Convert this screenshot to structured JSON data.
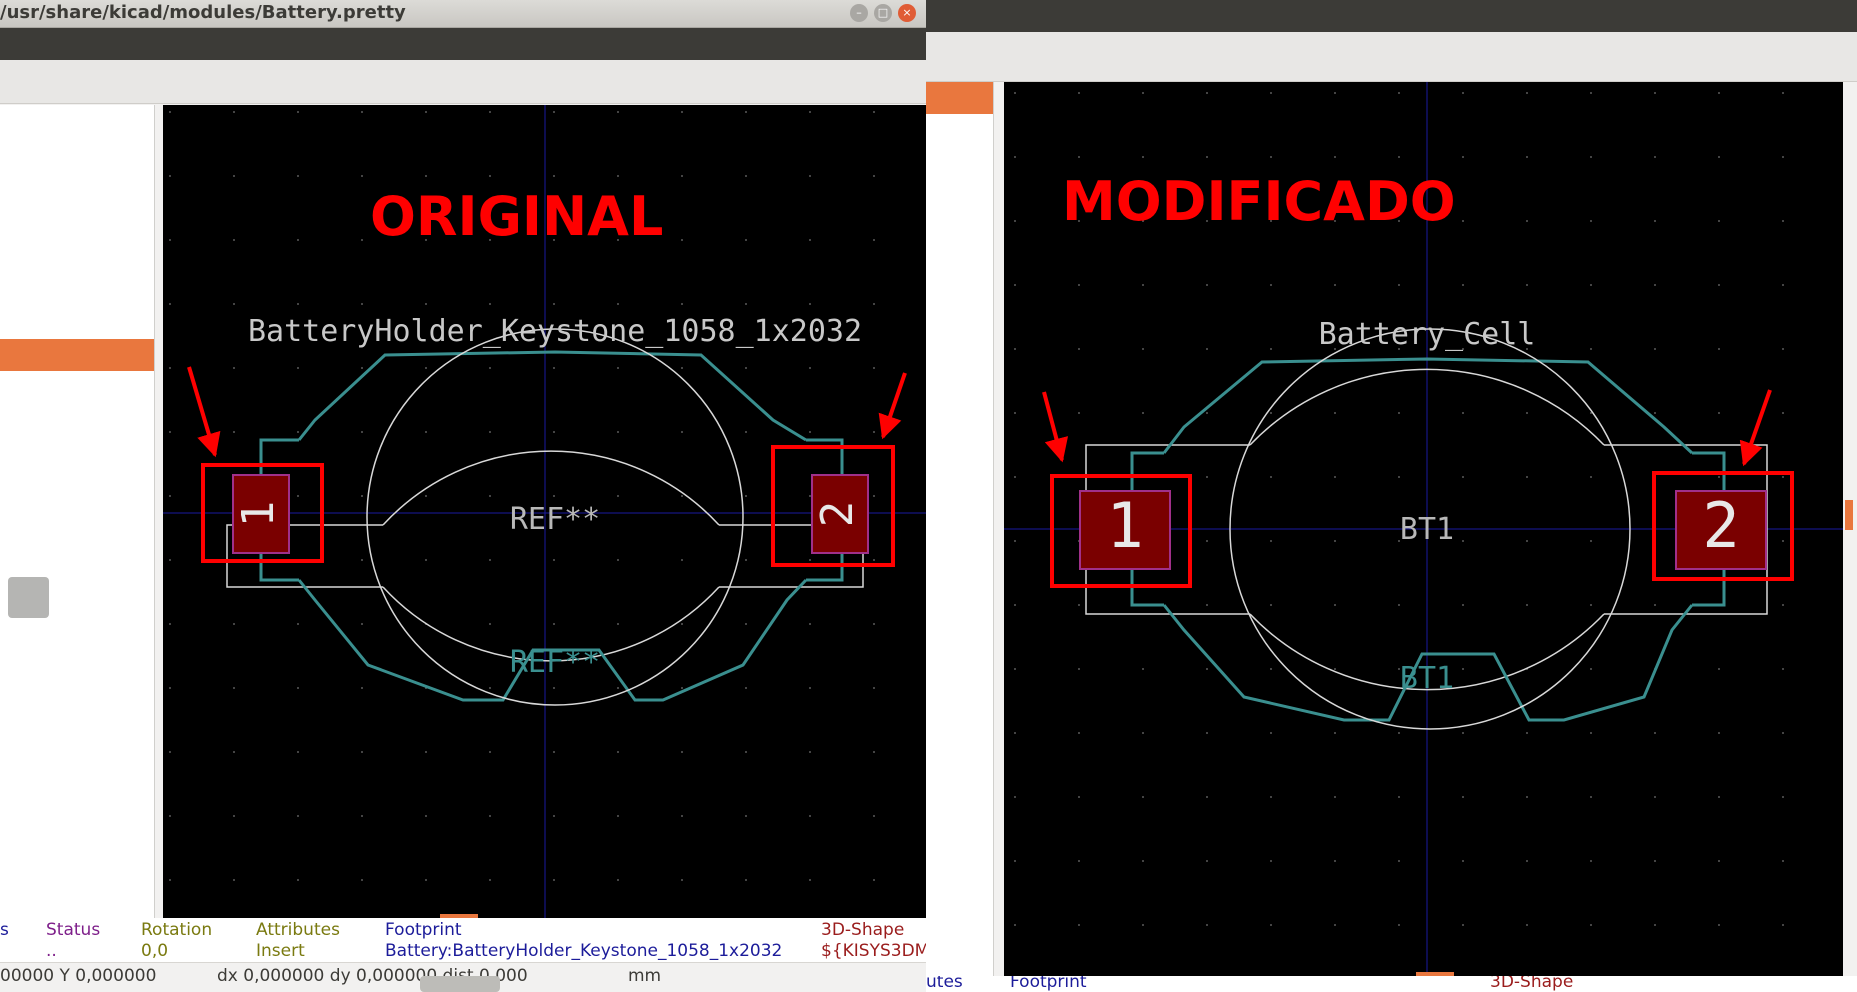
{
  "left_window": {
    "title": "/usr/share/kicad/modules/Battery.pretty",
    "window_buttons": {
      "minimize": "–",
      "maximize": "□",
      "close": "×"
    },
    "annotation": "ORIGINAL",
    "footprint_name": "BatteryHolder_Keystone_1058_1x2032",
    "reference": "REF**",
    "reference_fab": "REF**",
    "pads": [
      "1",
      "2"
    ],
    "msgpanel": {
      "cols": [
        {
          "header": "s",
          "value": ""
        },
        {
          "header": "Status",
          "value": ".."
        },
        {
          "header": "Rotation",
          "value": "0,0"
        },
        {
          "header": "Attributes",
          "value": "Insert"
        },
        {
          "header": "Footprint",
          "value": "Battery:BatteryHolder_Keystone_1058_1x2032"
        },
        {
          "header": "3D-Shape",
          "value": "${KISYS3DM"
        }
      ]
    },
    "status": {
      "xy": "00000  Y 0,000000",
      "dxdy": "dx 0,000000  dy 0,000000  dist 0,000",
      "units": "mm"
    }
  },
  "right_window": {
    "annotation": "MODIFICADO",
    "footprint_name": "Battery_Cell",
    "reference": "BT1",
    "reference_fab": "BT1",
    "pads": [
      "1",
      "2"
    ],
    "msgpanel": [
      {
        "header": "utes"
      },
      {
        "header": "Footprint"
      },
      {
        "header": "3D-Shape"
      }
    ]
  },
  "colors": {
    "annotation_red": "#ff0000",
    "courtyard": "#d8d8d8",
    "fab_layer": "#3a8f8f",
    "pad_fill": "#7a0000",
    "pad_border": "#a0308a",
    "grid_axis": "#1a1aa0",
    "accent_orange": "#e9773e",
    "msg_header_purple": "#7e1f8a",
    "msg_value_olive": "#7a7a10",
    "msg_value_blue": "#1c1c9a",
    "msg_value_red": "#9a1c1c"
  }
}
